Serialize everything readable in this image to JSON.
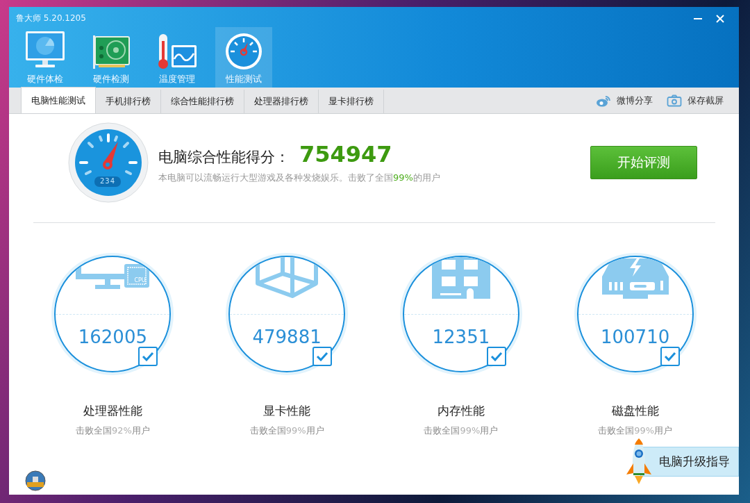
{
  "window": {
    "title": "鲁大师 5.20.1205"
  },
  "nav": [
    {
      "label": "硬件体检",
      "selected": false
    },
    {
      "label": "硬件检测",
      "selected": false
    },
    {
      "label": "温度管理",
      "selected": false
    },
    {
      "label": "性能测试",
      "selected": true
    }
  ],
  "tabs": [
    {
      "label": "电脑性能测试",
      "selected": true
    },
    {
      "label": "手机排行榜",
      "selected": false
    },
    {
      "label": "综合性能排行榜",
      "selected": false
    },
    {
      "label": "处理器排行榜",
      "selected": false
    },
    {
      "label": "显卡排行榜",
      "selected": false
    }
  ],
  "actions": [
    {
      "label": "微博分享"
    },
    {
      "label": "保存截屏"
    }
  ],
  "summary": {
    "gauge_reading": "234",
    "title": "电脑综合性能得分：",
    "score": "754947",
    "text_before": "本电脑可以流畅运行大型游戏及各种发烧娱乐。击败了全国",
    "percent": "99%",
    "text_after": "的用户",
    "button": "开始评测"
  },
  "cards": [
    {
      "icon_text": "CPU",
      "score": "162005",
      "checked": true,
      "label": "处理器性能",
      "text_before": "击败全国",
      "percent": "92%",
      "text_after": "用户"
    },
    {
      "score": "479881",
      "checked": true,
      "label": "显卡性能",
      "text_before": "击败全国",
      "percent": "99%",
      "text_after": "用户"
    },
    {
      "score": "12351",
      "checked": true,
      "label": "内存性能",
      "text_before": "击败全国",
      "percent": "99%",
      "text_after": "用户"
    },
    {
      "score": "100710",
      "checked": true,
      "label": "磁盘性能",
      "text_before": "击败全国",
      "percent": "99%",
      "text_after": "用户"
    }
  ],
  "upgrade_guide": {
    "label": "电脑升级指导"
  }
}
